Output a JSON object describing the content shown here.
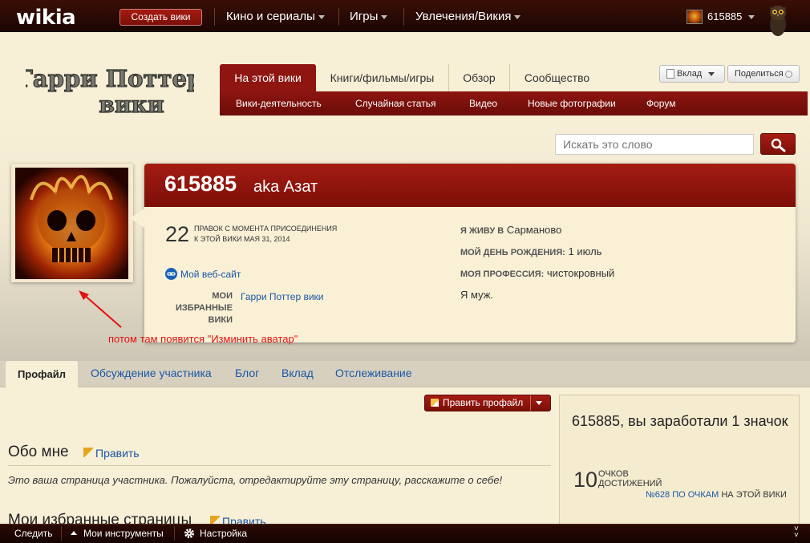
{
  "global_nav": {
    "logo": "wikia",
    "create_wiki": "Создать вики",
    "hubs": [
      "Кино и сериалы",
      "Игры",
      "Увлечения/Викия"
    ],
    "username": "615885"
  },
  "wiki_header": {
    "logo_line1": "Гарри Поттер",
    "logo_line2": "вики",
    "tabs": [
      "На этой вики",
      "Книги/фильмы/игры",
      "Обзор",
      "Сообщество"
    ],
    "subnav": [
      "Вики-деятельность",
      "Случайная статья",
      "Видео",
      "Новые фотографии",
      "Форум"
    ],
    "contribute": "Вклад",
    "share": "Поделиться"
  },
  "search": {
    "placeholder": "Искать это слово"
  },
  "profile": {
    "name": "615885",
    "aka": "aka Азат",
    "edits": "22",
    "edits_label_line1": "правок с момента присоединения",
    "edits_label_line2": "к этой вики",
    "join_date": "МАЯ 31, 2014",
    "website": "Мой веб-сайт",
    "fav_wikis_label": "Мои избранные вики",
    "fav_wiki": "Гарри Поттер вики",
    "location_label": "Я живу в",
    "location": "Сарманово",
    "birthday_label": "Мой день рождения:",
    "birthday": "1 июль",
    "occupation_label": "Моя профессия:",
    "occupation": "чистокровный",
    "gender": "Я муж."
  },
  "annotation": "потом там появится \"Изминить аватар\"",
  "profile_tabs": [
    "Профайл",
    "Обсуждение участника",
    "Блог",
    "Вклад",
    "Отслеживание"
  ],
  "content": {
    "edit_profile": "Править профайл",
    "about_title": "Обо мне",
    "edit": "Править",
    "about_text": "Это ваша страница участника. Пожалуйста, отредактируйте эту страницу, расскажите о себе!",
    "fav_pages_title": "Мои избранные страницы"
  },
  "achievements": {
    "title": "615885, вы заработали 1 значок",
    "points": "10",
    "points_label_line1": "очков",
    "points_label_line2": "достижений",
    "rank": "№628 по очкам",
    "rank_suffix": "на этой вики"
  },
  "toolbar": {
    "follow": "Следить",
    "my_tools": "Мои инструменты",
    "settings": "Настройка"
  },
  "colors": {
    "brand_red": "#8e1510",
    "link_blue": "#1a57a6",
    "annotation_red": "#e41212",
    "page_bg": "#f7efd6"
  }
}
